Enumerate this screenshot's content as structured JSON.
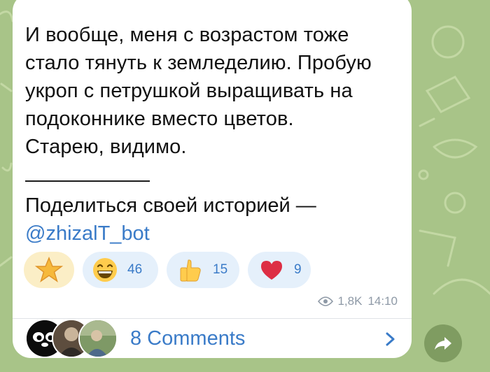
{
  "message": {
    "lines": [
      "И вообще, меня с возрастом тоже",
      "стало тянуть к земледелию. Пробую",
      "укроп с петрушкой выращивать на",
      "подоконнике вместо цветов.",
      "Старею, видимо."
    ],
    "separator": "___________",
    "share_prompt": "Поделиться своей историей —",
    "bot_link": "@zhizalT_bot"
  },
  "reactions": [
    {
      "emoji": "star",
      "count": ""
    },
    {
      "emoji": "grinning-face",
      "count": "46"
    },
    {
      "emoji": "thumbs-up",
      "count": "15"
    },
    {
      "emoji": "red-heart",
      "count": "9"
    }
  ],
  "meta": {
    "views": "1,8K",
    "time": "14:10"
  },
  "comments": {
    "label": "8 Comments"
  },
  "colors": {
    "accent": "#3a7bc8",
    "bubble": "#ffffff",
    "wallpaper": "#a8c488",
    "reaction_bg": "#e5f0fb",
    "share_button": "#7f9c61"
  }
}
